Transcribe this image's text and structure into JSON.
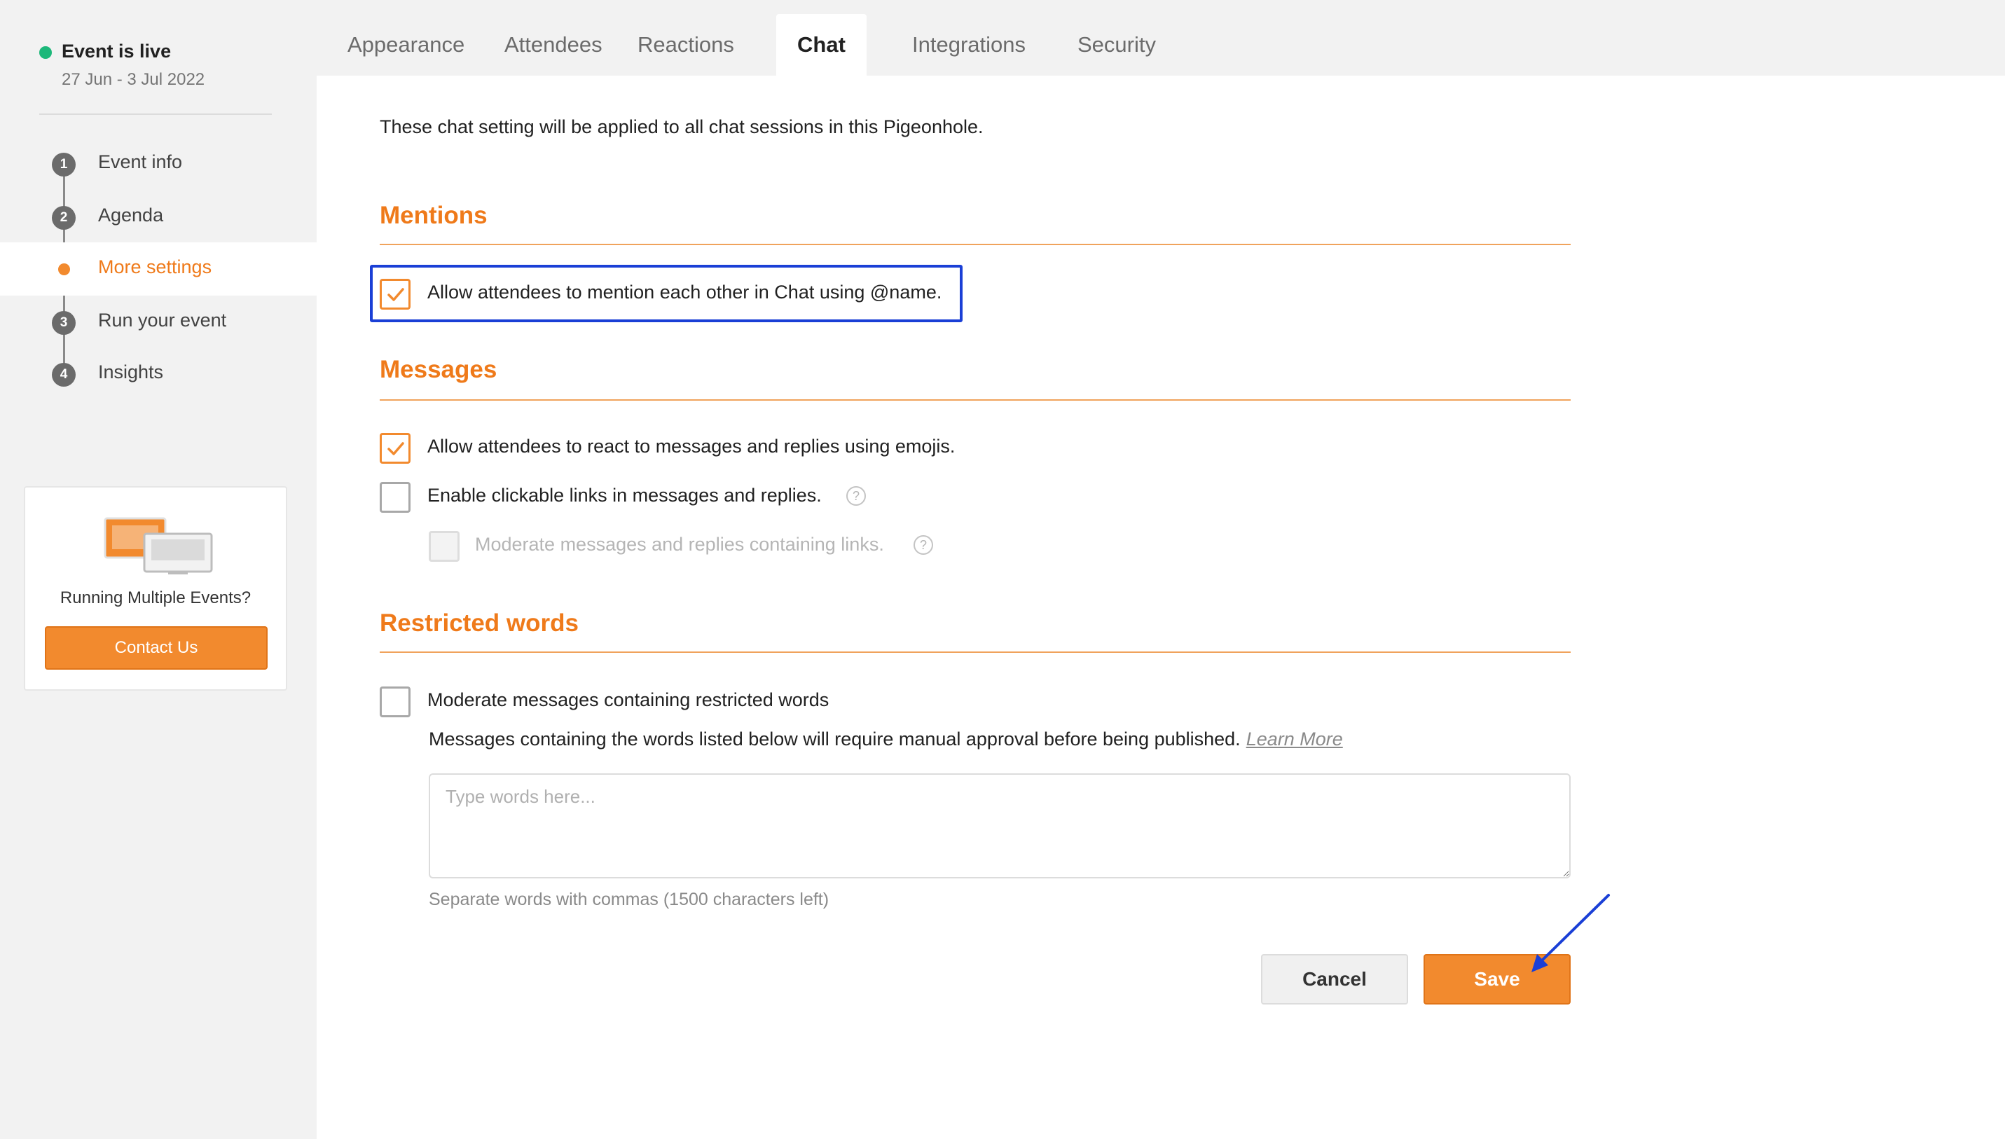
{
  "sidebar": {
    "status": {
      "title": "Event is live",
      "date": "27 Jun - 3 Jul 2022",
      "color": "#1db87a"
    },
    "steps": [
      {
        "badge": "1",
        "label": "Event info",
        "active": false
      },
      {
        "badge": "2",
        "label": "Agenda",
        "active": false
      },
      {
        "badge": "",
        "label": "More settings",
        "active": true
      },
      {
        "badge": "3",
        "label": "Run your event",
        "active": false
      },
      {
        "badge": "4",
        "label": "Insights",
        "active": false
      }
    ],
    "promo": {
      "text": "Running Multiple Events?",
      "button_label": "Contact Us",
      "illustration": "monitors-icon"
    }
  },
  "tabs": [
    {
      "label": "Appearance",
      "active": false
    },
    {
      "label": "Attendees",
      "active": false
    },
    {
      "label": "Reactions",
      "active": false
    },
    {
      "label": "Chat",
      "active": true
    },
    {
      "label": "Integrations",
      "active": false
    },
    {
      "label": "Security",
      "active": false
    }
  ],
  "main": {
    "intro": "These chat setting will be applied to all chat sessions in this Pigeonhole.",
    "mentions": {
      "title": "Mentions",
      "options": [
        {
          "label": "Allow attendees to mention each other in Chat using @name.",
          "checked": true,
          "highlighted": true
        }
      ]
    },
    "messages": {
      "title": "Messages",
      "options": [
        {
          "label": "Allow attendees to react to messages and replies using emojis.",
          "checked": true
        },
        {
          "label": "Enable clickable links in messages and replies.",
          "checked": false,
          "help_icon": "question-icon"
        },
        {
          "label": "Moderate messages and replies containing links.",
          "checked": false,
          "disabled": true,
          "help_icon": "question-icon"
        }
      ]
    },
    "restricted": {
      "title": "Restricted words",
      "option": {
        "label": "Moderate messages containing restricted words",
        "checked": false
      },
      "description": "Messages containing the words listed below will require manual approval before being published.",
      "learn_more": "Learn More",
      "input_value": "",
      "input_placeholder": "Type words here...",
      "hint": "Separate words with commas (1500 characters left)"
    },
    "actions": {
      "cancel_label": "Cancel",
      "save_label": "Save"
    }
  },
  "colors": {
    "accent": "#f28a2e",
    "accent_text": "#ef7a1a",
    "highlight_border": "#1a3fd6",
    "sidebar_bg": "#f2f2f2"
  }
}
